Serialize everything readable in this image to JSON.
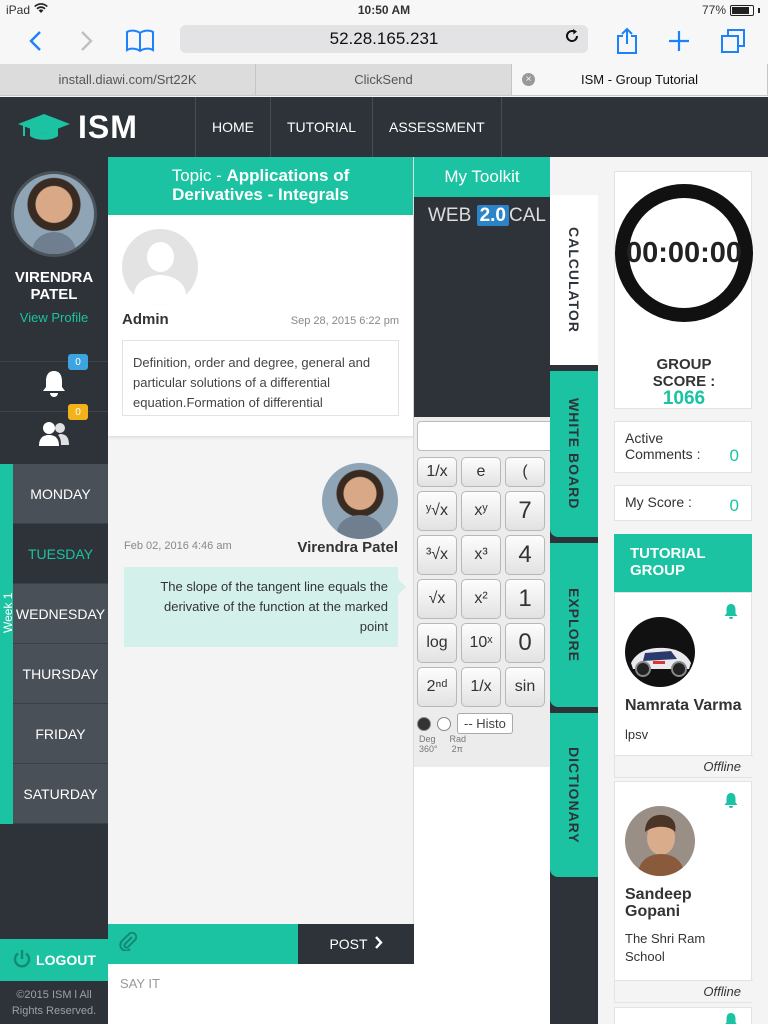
{
  "status_bar": {
    "device": "iPad",
    "time": "10:50 AM",
    "battery": "77%"
  },
  "safari": {
    "url": "52.28.165.231"
  },
  "tabs": [
    {
      "label": "install.diawi.com/Srt22K"
    },
    {
      "label": "ClickSend"
    },
    {
      "label": "ISM - Group Tutorial"
    }
  ],
  "header": {
    "logo_text": "ISM",
    "nav": [
      "HOME",
      "TUTORIAL",
      "ASSESSMENT"
    ]
  },
  "profile": {
    "name_line1": "VIRENDRA",
    "name_line2": "PATEL",
    "view_profile": "View Profile",
    "notifications_count": "0",
    "group_count": "0"
  },
  "week": {
    "label": "Week 1",
    "days": [
      "MONDAY",
      "TUESDAY",
      "WEDNESDAY",
      "THURSDAY",
      "FRIDAY",
      "SATURDAY"
    ],
    "active_day": "TUESDAY"
  },
  "sidebar": {
    "logout": "LOGOUT",
    "copyright_line1": "©2015 ISM l All",
    "copyright_line2": "Rights Reserved."
  },
  "topic": {
    "prefix": "Topic - ",
    "title_line1": "Applications of",
    "title_line2": "Derivatives - Integrals"
  },
  "admin_post": {
    "author": "Admin",
    "date": "Sep 28, 2015 6:22 pm",
    "message": "Definition, order and degree, general and particular solutions of a differential equation.Formation of differential"
  },
  "reply": {
    "author": "Virendra Patel",
    "date": "Feb 02, 2016 4:46 am",
    "message": "The slope of the tangent line equals the derivative of the function at the marked point"
  },
  "composer": {
    "post_label": "POST",
    "placeholder": "SAY IT"
  },
  "toolkit": {
    "title": "My Toolkit",
    "calc_brand_prefix": "WEB",
    "calc_brand_version": "2.0",
    "calc_brand_suffix": "CAL",
    "keys": [
      "1/x",
      "e",
      "(",
      "ʸ√x",
      "xʸ",
      "7",
      "³√x",
      "x³",
      "4",
      "√x",
      "x²",
      "1",
      "log",
      "10ˣ",
      "0",
      "2ⁿᵈ",
      "1/x",
      "sin"
    ],
    "opt_deg": "Deg",
    "opt_rad": "Rad",
    "deg_sub": "360°",
    "rad_sub": "2π",
    "history": "-- Histo"
  },
  "side_tabs": [
    "CALCULATOR",
    "WHITE BOARD",
    "EXPLORE",
    "DICTIONARY"
  ],
  "score": {
    "timer": "00:00:00",
    "group_score_label_1": "GROUP",
    "group_score_label_2": "SCORE :",
    "group_score_value": "1066",
    "active_comments_label_1": "Active",
    "active_comments_label_2": "Comments :",
    "active_comments_value": "0",
    "my_score_label": "My Score :",
    "my_score_value": "0"
  },
  "tutorial_group": {
    "title_line1": "TUTORIAL",
    "title_line2": "GROUP",
    "members": [
      {
        "name_line1": "Namrata Varma",
        "name_line2": "",
        "sub_line1": "lpsv",
        "sub_line2": "",
        "status": "Offline"
      },
      {
        "name_line1": "Sandeep",
        "name_line2": "Gopani",
        "sub_line1": "The Shri Ram",
        "sub_line2": "School",
        "status": "Offline"
      }
    ]
  },
  "colors": {
    "accent": "#1bc3a2",
    "dark": "#2d3339",
    "ios_blue": "#1a82fb"
  }
}
